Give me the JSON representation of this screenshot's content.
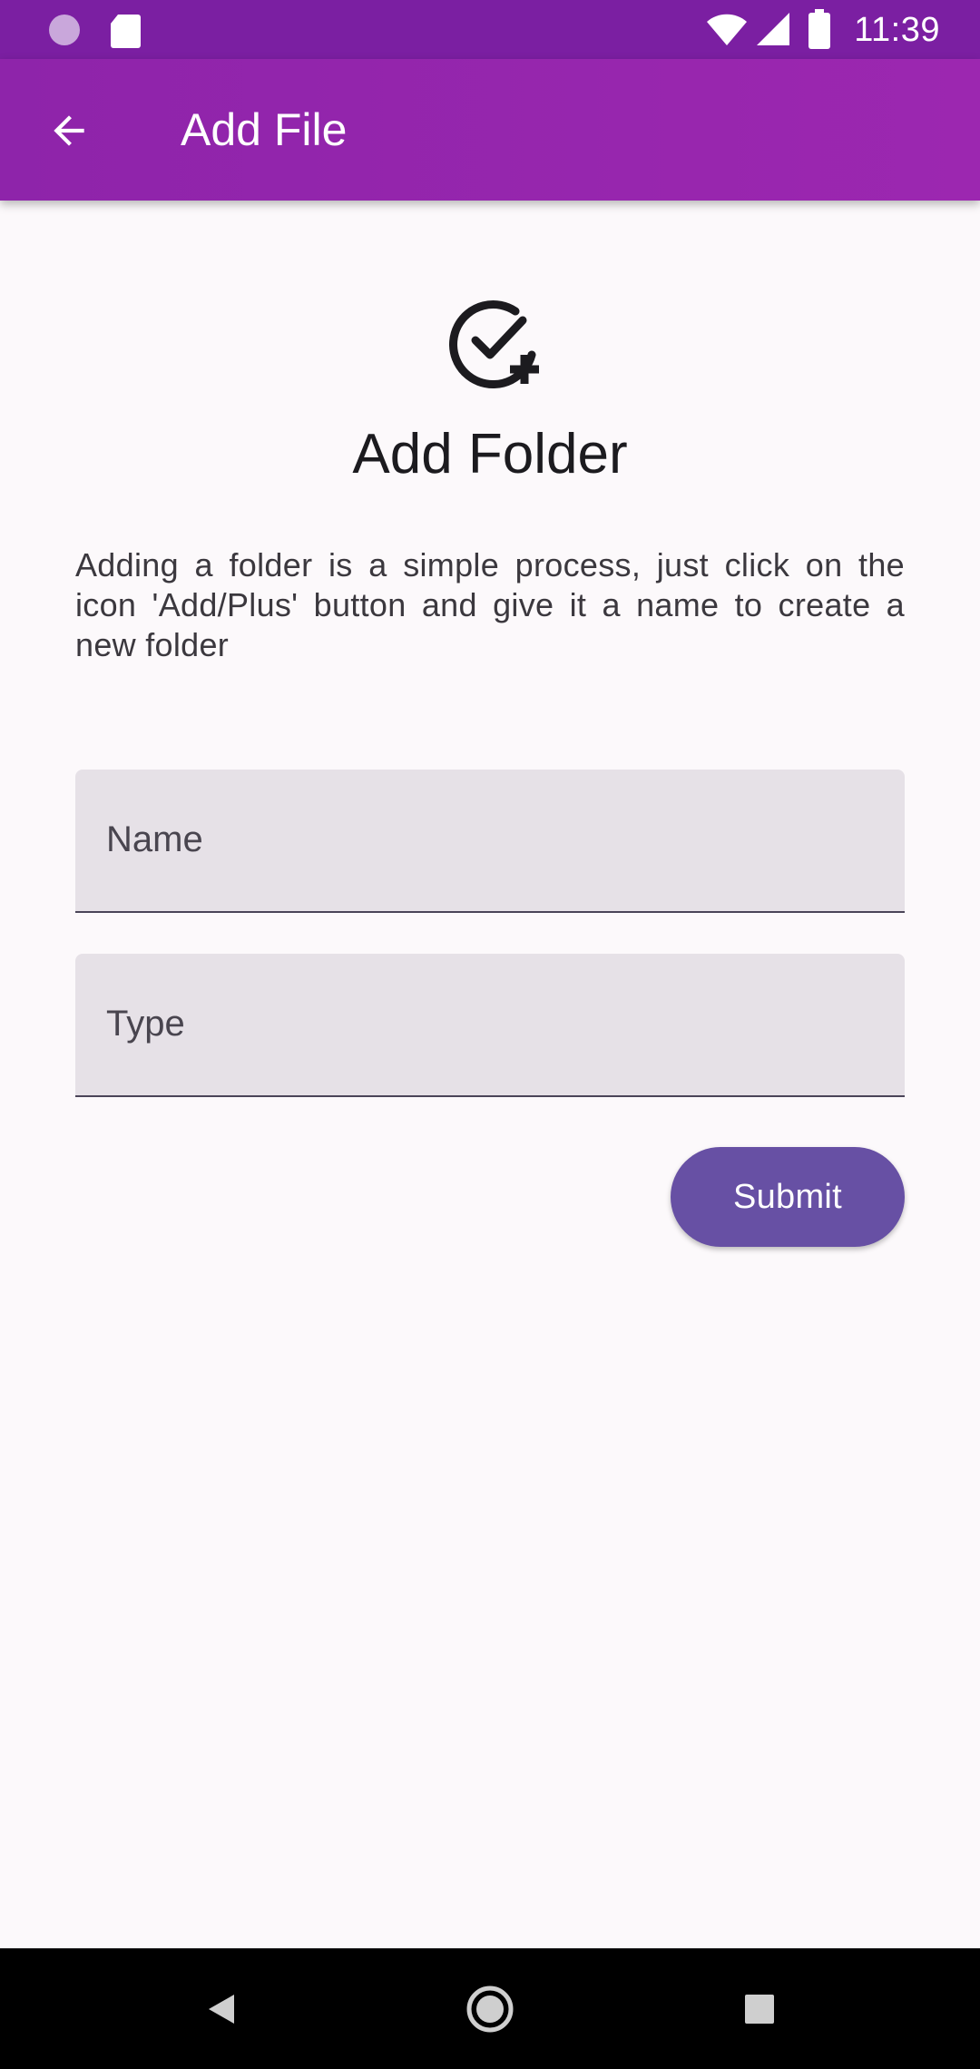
{
  "status_bar": {
    "time": "11:39",
    "icons": [
      "notification-dot-icon",
      "sd-card-icon",
      "wifi-icon",
      "cell-signal-icon",
      "battery-icon"
    ]
  },
  "app_bar": {
    "title": "Add File",
    "back_icon": "arrow-back-icon",
    "color": "#9c27b0"
  },
  "main": {
    "icon": "check-circle-plus-icon",
    "heading": "Add Folder",
    "description": "Adding a folder is a simple process, just click on the icon 'Add/Plus' button and give it a name to create a new folder"
  },
  "form": {
    "name_label": "Name",
    "type_label": "Type",
    "submit_label": "Submit",
    "accent": "#6750a4"
  },
  "nav_bar": {
    "icons": [
      "back-triangle-icon",
      "home-circle-icon",
      "recents-square-icon"
    ]
  }
}
